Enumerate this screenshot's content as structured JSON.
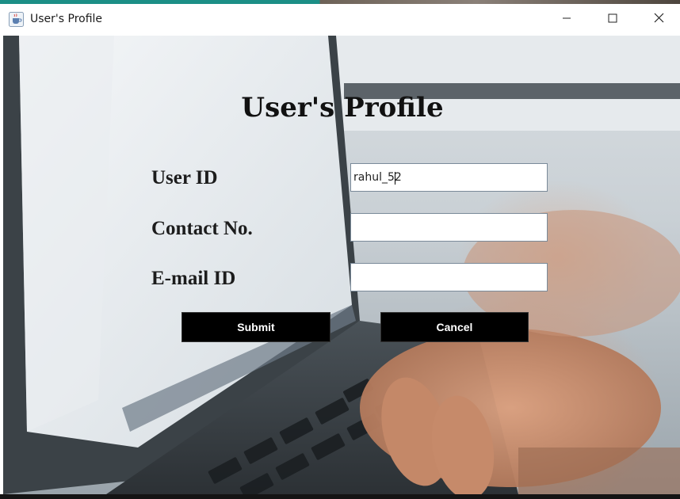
{
  "window": {
    "title": "User's Profile",
    "icon": "java-coffee-cup-icon",
    "controls": [
      "minimize-icon",
      "maximize-icon",
      "close-icon"
    ]
  },
  "form": {
    "heading": "User's Profile",
    "fields": [
      {
        "label": "User ID",
        "value": "rahul_52",
        "placeholder": ""
      },
      {
        "label": "Contact No.",
        "value": "",
        "placeholder": ""
      },
      {
        "label": "E-mail ID",
        "value": "",
        "placeholder": ""
      }
    ],
    "buttons": {
      "submit": "Submit",
      "cancel": "Cancel"
    }
  },
  "colors": {
    "button_bg": "#000000",
    "button_text": "#ffffff",
    "label_text": "#1c1c1c",
    "accent_bar": "#1c8f86"
  }
}
